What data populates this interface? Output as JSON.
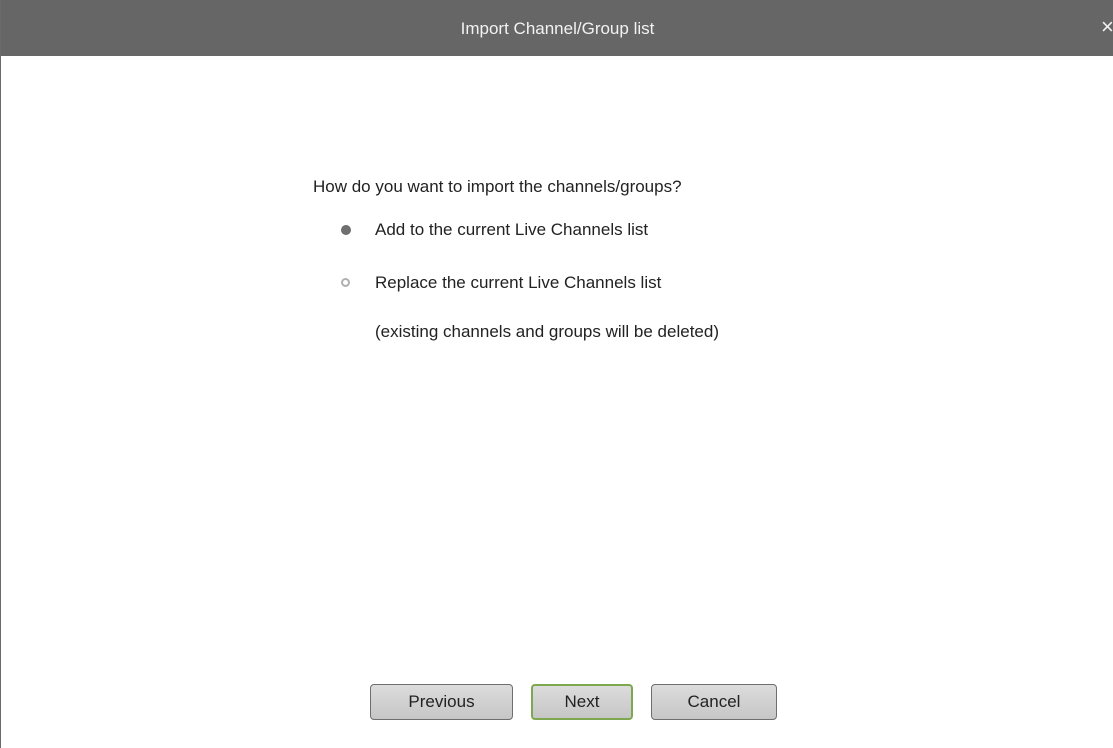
{
  "dialog": {
    "title": "Import Channel/Group list",
    "close_glyph": "×"
  },
  "content": {
    "question": "How do you want to import the channels/groups?",
    "options": [
      {
        "label": "Add to the current Live Channels list",
        "selected": true
      },
      {
        "label": "Replace the current Live Channels list",
        "selected": false
      }
    ],
    "note": "(existing channels and groups will be deleted)"
  },
  "buttons": {
    "previous": "Previous",
    "next": "Next",
    "cancel": "Cancel"
  },
  "colors": {
    "titlebar": "#666666",
    "focus_border": "#7ea84f",
    "button_face": "#cfcfcf"
  },
  "icons": {
    "close": "close-icon",
    "radio_selected": "radio-selected-icon",
    "radio_unselected": "radio-unselected-icon"
  }
}
